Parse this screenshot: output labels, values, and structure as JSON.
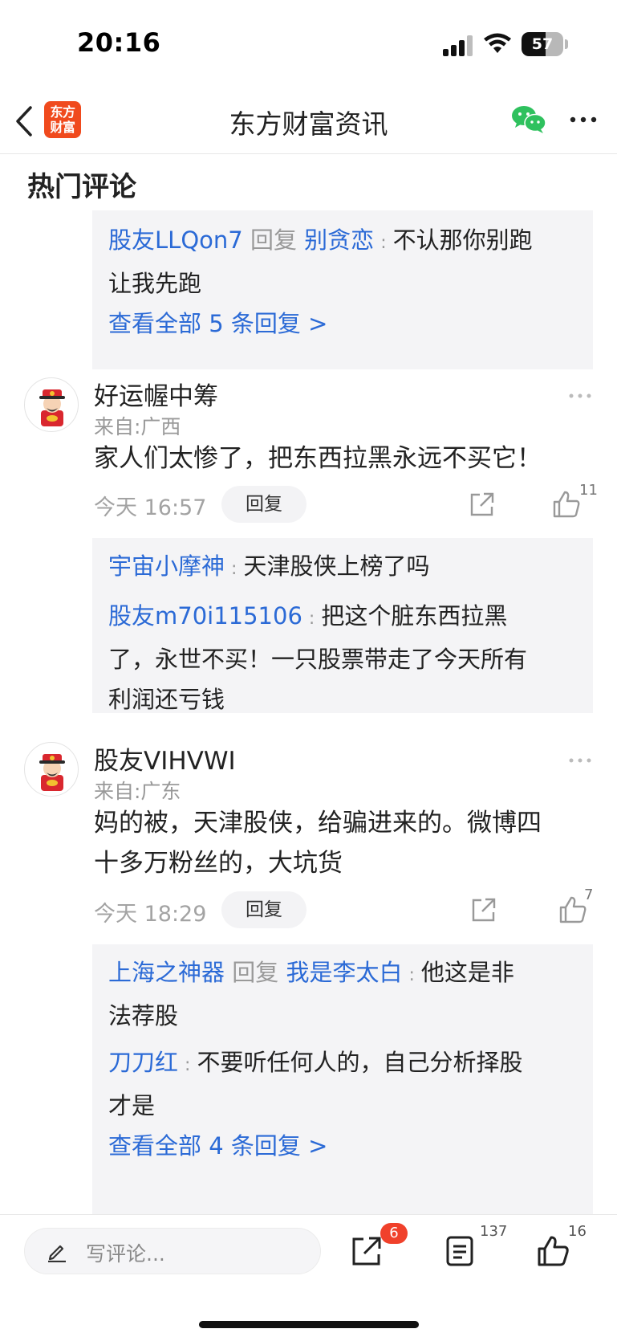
{
  "status_bar": {
    "time": "20:16",
    "battery": "57",
    "battery_level": 0.57
  },
  "nav": {
    "logo_text_1": "东方",
    "logo_text_2": "财富",
    "title": "东方财富资讯"
  },
  "section_title": "热门评论",
  "prev_thread": {
    "replies": [
      {
        "user": "股友LLQon7",
        "reply_word": "回复",
        "target": "别贪恋",
        "text_1": "不认那你别跑",
        "text_2": "让我先跑"
      }
    ],
    "view_all": "查看全部 5 条回复 >"
  },
  "comments": [
    {
      "username": "好运幄中筹",
      "location": "来自:广西",
      "content": "家人们太惨了，把东西拉黑永远不买它！",
      "time": "今天 16:57",
      "reply_label": "回复",
      "likes": "11",
      "replies": [
        {
          "user": "宇宙小摩神",
          "text": "天津股侠上榜了吗"
        },
        {
          "user": "股友m70i115106",
          "text_1": "把这个脏东西拉黑",
          "text_2": "了，永世不买！一只股票带走了今天所有",
          "text_3": "利润还亏钱"
        }
      ]
    },
    {
      "username": "股友VIHVWI",
      "location": "来自:广东",
      "content_1": "妈的被，天津股侠，给骗进来的。微博四",
      "content_2": "十多万粉丝的，大坑货",
      "time": "今天 18:29",
      "reply_label": "回复",
      "likes": "7",
      "replies": [
        {
          "user": "上海之神器",
          "reply_word": "回复",
          "target": "我是李太白",
          "text_1": "他这是非",
          "text_2": "法荐股"
        },
        {
          "user": "刀刀红",
          "text_1": "不要听任何人的，自己分析择股",
          "text_2": "才是"
        }
      ],
      "view_all": "查看全部 4 条回复 >"
    }
  ],
  "bottom_bar": {
    "input_placeholder": "写评论...",
    "share_badge": "6",
    "comment_count": "137",
    "like_count": "16"
  },
  "colors": {
    "link_blue": "#2b6ad6",
    "brand_orange": "#f04a1d",
    "badge_red": "#f0412b",
    "reply_bg": "#f4f4f6"
  },
  "icons": [
    "back-icon",
    "wechat-icon",
    "more-icon",
    "share-icon",
    "thumbs-up-icon",
    "pen-icon",
    "comment-list-icon"
  ]
}
